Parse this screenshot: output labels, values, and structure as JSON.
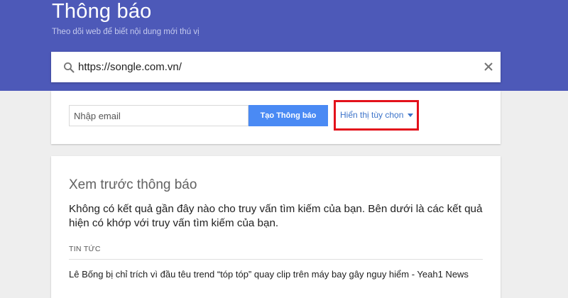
{
  "header": {
    "title": "Thông báo",
    "subtitle": "Theo dõi web để biết nội dung mới thú vị",
    "background_color": "#4d59b8"
  },
  "search": {
    "icon": "search-icon",
    "value": "https://songle.com.vn/",
    "clear_icon": "close-icon"
  },
  "create_form": {
    "email_placeholder": "Nhập email",
    "create_button_label": "Tạo Thông báo",
    "options_label": "Hiển thị tùy chọn",
    "options_icon": "caret-down-icon",
    "highlight_color": "#e3111b",
    "button_color": "#4a8af4"
  },
  "preview": {
    "title": "Xem trước thông báo",
    "description": "Không có kết quả gần đây nào cho truy vấn tìm kiếm của bạn. Bên dưới là các kết quả hiện có khớp với truy vấn tìm kiếm của bạn.",
    "section_label": "TIN TỨC",
    "news_items": [
      {
        "title": "Lê Bống bị chỉ trích vì đầu têu trend “tóp tóp” quay clip trên máy bay gây nguy hiểm - Yeah1 News"
      }
    ]
  }
}
